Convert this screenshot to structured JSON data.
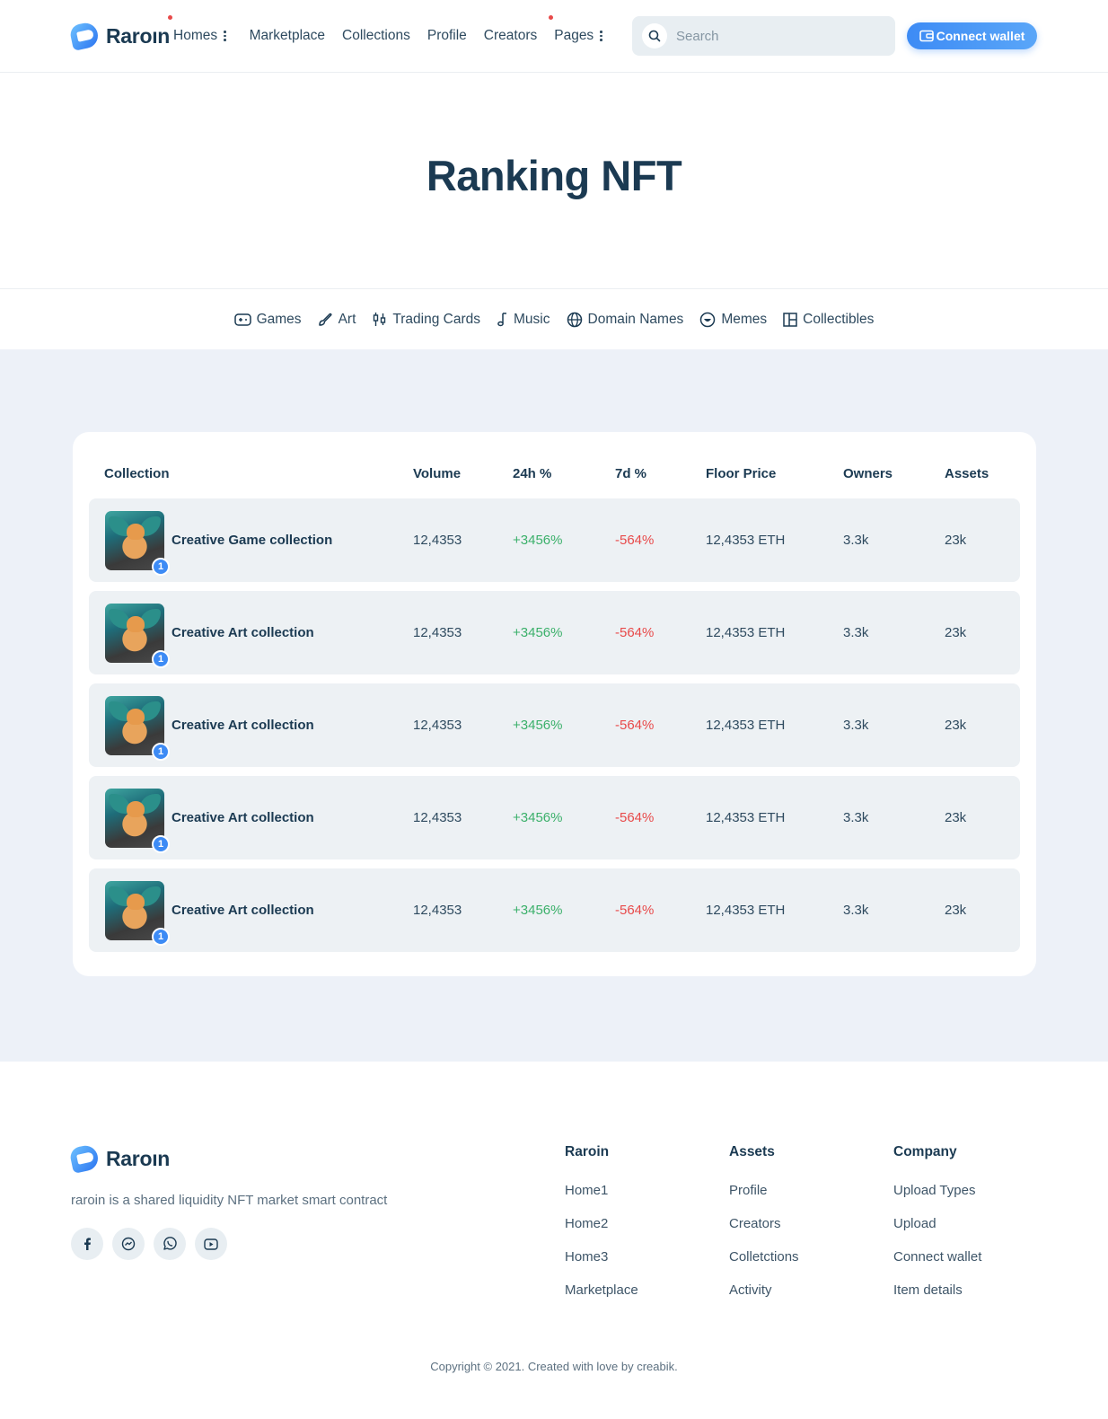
{
  "brand": {
    "name": "Raroın"
  },
  "nav": {
    "items": [
      {
        "label": "Homes",
        "has_menu": true,
        "dot": true
      },
      {
        "label": "Marketplace"
      },
      {
        "label": "Collections"
      },
      {
        "label": "Profile"
      },
      {
        "label": "Creators"
      },
      {
        "label": "Pages",
        "has_menu": true,
        "dot": true
      }
    ],
    "search_placeholder": "Search",
    "connect_label": "Connect wallet"
  },
  "hero": {
    "title": "Ranking NFT"
  },
  "categories": [
    {
      "label": "Games",
      "icon": "gamepad-icon"
    },
    {
      "label": "Art",
      "icon": "brush-icon"
    },
    {
      "label": "Trading Cards",
      "icon": "candlestick-icon"
    },
    {
      "label": "Music",
      "icon": "music-note-icon"
    },
    {
      "label": "Domain Names",
      "icon": "globe-icon"
    },
    {
      "label": "Memes",
      "icon": "smiley-icon"
    },
    {
      "label": "Collectibles",
      "icon": "grid-icon"
    }
  ],
  "table": {
    "headers": [
      "Collection",
      "Volume",
      "24h %",
      "7d %",
      "Floor Price",
      "Owners",
      "Assets"
    ],
    "rows": [
      {
        "name": "Creative Game collection",
        "badge": "1",
        "volume": "12,4353",
        "h24": "+3456%",
        "d7": "-564%",
        "floor": "12,4353 ETH",
        "owners": "3.3k",
        "assets": "23k"
      },
      {
        "name": "Creative Art collection",
        "badge": "1",
        "volume": "12,4353",
        "h24": "+3456%",
        "d7": "-564%",
        "floor": "12,4353 ETH",
        "owners": "3.3k",
        "assets": "23k"
      },
      {
        "name": "Creative Art collection",
        "badge": "1",
        "volume": "12,4353",
        "h24": "+3456%",
        "d7": "-564%",
        "floor": "12,4353 ETH",
        "owners": "3.3k",
        "assets": "23k"
      },
      {
        "name": "Creative Art collection",
        "badge": "1",
        "volume": "12,4353",
        "h24": "+3456%",
        "d7": "-564%",
        "floor": "12,4353 ETH",
        "owners": "3.3k",
        "assets": "23k"
      },
      {
        "name": "Creative Art collection",
        "badge": "1",
        "volume": "12,4353",
        "h24": "+3456%",
        "d7": "-564%",
        "floor": "12,4353 ETH",
        "owners": "3.3k",
        "assets": "23k"
      }
    ]
  },
  "footer": {
    "brand": "Raroın",
    "description": "raroin is a shared liquidity NFT market smart contract",
    "socials": [
      "facebook-icon",
      "messenger-icon",
      "whatsapp-icon",
      "youtube-icon"
    ],
    "columns": [
      {
        "title": "Raroin",
        "links": [
          "Home1",
          "Home2",
          "Home3",
          "Marketplace"
        ]
      },
      {
        "title": "Assets",
        "links": [
          "Profile",
          "Creators",
          "Colletctions",
          "Activity"
        ]
      },
      {
        "title": "Company",
        "links": [
          "Upload Types",
          "Upload",
          "Connect wallet",
          "Item details"
        ]
      }
    ],
    "copyright": "Copyright © 2021. Created with love by creabik."
  },
  "colors": {
    "accent": "#3d8bf5",
    "positive": "#3bb06a",
    "negative": "#e84a4a",
    "band": "#edf1f8"
  }
}
